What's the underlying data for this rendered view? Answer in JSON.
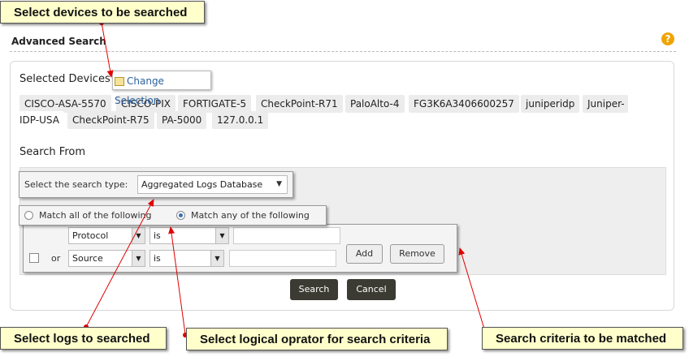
{
  "callouts": {
    "devices": "Select devices to be searched",
    "logs": "Select logs to searched",
    "logical": "Select logical oprator for search criteria",
    "criteria": "Search criteria to be matched"
  },
  "header": {
    "title": "Advanced Search",
    "help": "?"
  },
  "devices": {
    "label": "Selected Devices",
    "change_selection": "Change Selection",
    "items": [
      "CISCO-ASA-5570",
      "CISCO-PIX",
      "FORTIGATE-5",
      "CheckPoint-R71",
      "PaloAlto-4",
      "FG3K6A3406600257",
      "juniperidp",
      "Juniper-",
      "IDP-USA",
      "CheckPoint-R75",
      "PA-5000",
      "127.0.0.1"
    ]
  },
  "search_from": {
    "label": "Search From",
    "type_label": "Select the search type:",
    "type_value": "Aggregated Logs Database"
  },
  "match": {
    "all_label": "Match all of the following",
    "any_label": "Match any of the following",
    "selected": "any"
  },
  "criteria_rows": [
    {
      "connector": "",
      "field": "Protocol",
      "operator": "is",
      "value": ""
    },
    {
      "connector": "or",
      "field": "Source",
      "operator": "is",
      "value": ""
    }
  ],
  "buttons": {
    "add": "Add",
    "remove": "Remove",
    "search": "Search",
    "cancel": "Cancel"
  },
  "colors": {
    "callout_bg": "#ffffcc",
    "arrow": "#e00000",
    "dark_button": "#3b3b33",
    "help": "#f0a400"
  }
}
